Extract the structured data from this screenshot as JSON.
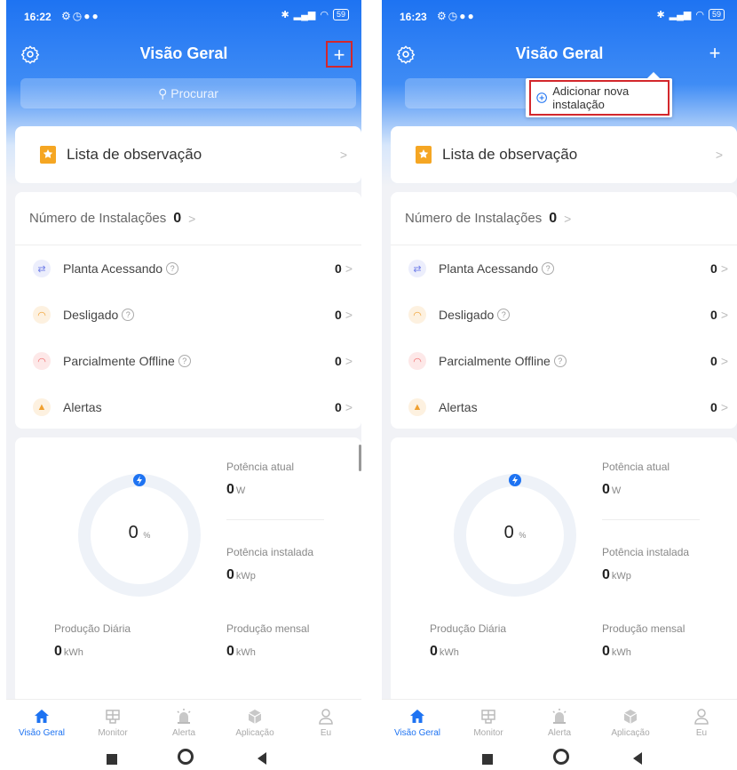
{
  "colors": {
    "primary": "#1e73f2",
    "highlight_box": "#d3272c",
    "online": "#6f7ee8",
    "offline": "#f0a030",
    "partial": "#f06a6a",
    "alert": "#f0a030"
  },
  "screens": [
    {
      "status": {
        "time": "16:22",
        "battery": "59"
      },
      "nav": {
        "title": "Visão Geral",
        "add": "+"
      },
      "search": {
        "placeholder": "Procurar"
      },
      "watchlist": {
        "label": "Lista de observação"
      },
      "installations": {
        "label": "Número de Instalações",
        "count": "0",
        "rows": [
          {
            "label": "Planta Acessando",
            "value": "0"
          },
          {
            "label": "Desligado",
            "value": "0"
          },
          {
            "label": "Parcialmente Offline",
            "value": "0"
          },
          {
            "label": "Alertas",
            "value": "0"
          }
        ]
      },
      "power": {
        "percent": "0",
        "percent_unit": "%",
        "current_label": "Potência atual",
        "current_value": "0",
        "current_unit": "W",
        "installed_label": "Potência instalada",
        "installed_value": "0",
        "installed_unit": "kWp",
        "daily_label": "Produção Diária",
        "daily_value": "0",
        "daily_unit": "kWh",
        "monthly_label": "Produção mensal",
        "monthly_value": "0",
        "monthly_unit": "kWh"
      },
      "tabs": [
        "Visão Geral",
        "Monitor",
        "Alerta",
        "Aplicação",
        "Eu"
      ]
    },
    {
      "status": {
        "time": "16:23",
        "battery": "59"
      },
      "nav": {
        "title": "Visão Geral",
        "add": "+"
      },
      "popup": {
        "label": "Adicionar nova instalação"
      },
      "watchlist": {
        "label": "Lista de observação"
      },
      "installations": {
        "label": "Número de Instalações",
        "count": "0",
        "rows": [
          {
            "label": "Planta Acessando",
            "value": "0"
          },
          {
            "label": "Desligado",
            "value": "0"
          },
          {
            "label": "Parcialmente Offline",
            "value": "0"
          },
          {
            "label": "Alertas",
            "value": "0"
          }
        ]
      },
      "power": {
        "percent": "0",
        "percent_unit": "%",
        "current_label": "Potência atual",
        "current_value": "0",
        "current_unit": "W",
        "installed_label": "Potência instalada",
        "installed_value": "0",
        "installed_unit": "kWp",
        "daily_label": "Produção Diária",
        "daily_value": "0",
        "daily_unit": "kWh",
        "monthly_label": "Produção mensal",
        "monthly_value": "0",
        "monthly_unit": "kWh"
      },
      "tabs": [
        "Visão Geral",
        "Monitor",
        "Alerta",
        "Aplicação",
        "Eu"
      ]
    }
  ]
}
